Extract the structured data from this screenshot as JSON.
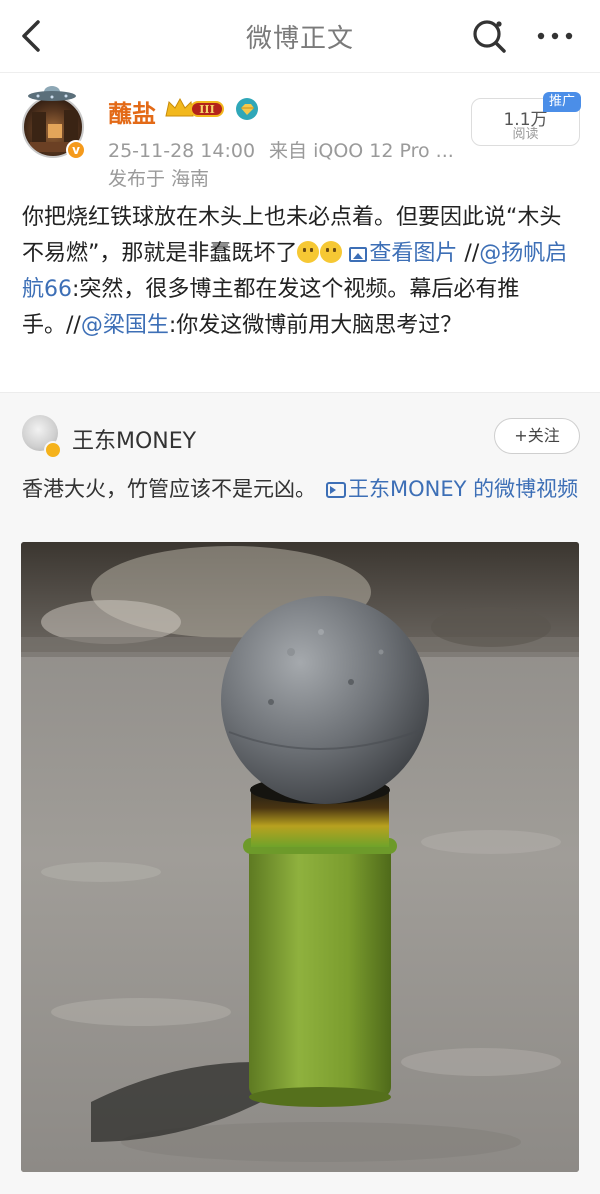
{
  "nav": {
    "title": "微博正文"
  },
  "author": {
    "name": "蘸盐",
    "level_badge": "III",
    "timestamp": "25-11-28 14:00",
    "device": "来自 iQOO 12 Pro ...",
    "location": "发布于 海南",
    "reads_count": "1.1万",
    "reads_label": "阅读",
    "promo_tag": "推广"
  },
  "post": {
    "text_part1": "你把烧红铁球放在木头上也未必点着。但要因此说“木头不易燃”，那就是非蠢既坏了",
    "view_image_label": "查看图片",
    "separator1": " //",
    "mention1": "@扬帆启航66",
    "text_part2": ":突然，很多博主都在发这个视频。幕后必有推手。//",
    "mention2": "@梁国生",
    "text_part3": ":你发这微博前用大脑思考过？"
  },
  "repost": {
    "author_name": "王东MONEY",
    "follow_label": "+关注",
    "text": "香港大火，竹管应该不是元凶。",
    "video_link": "王东MONEY 的微博视频"
  },
  "colors": {
    "link": "#3d6fb6",
    "username": "#e36a17",
    "promo": "#4b8ee8"
  },
  "icons": [
    "back-arrow-icon",
    "search-icon",
    "more-icon",
    "picture-icon",
    "video-icon",
    "crown-level-icon",
    "diamond-icon"
  ]
}
